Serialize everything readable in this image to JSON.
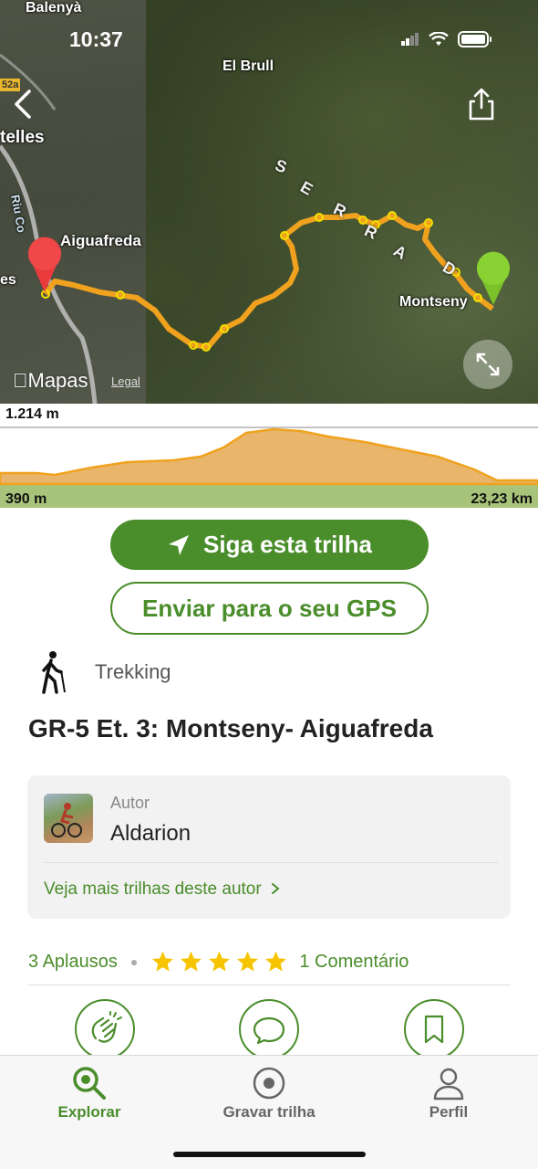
{
  "status_bar": {
    "time": "10:37"
  },
  "map": {
    "labels": {
      "balenya": "Balenyà",
      "el_brull": "El Brull",
      "road_52a": "52a",
      "cardedeu_partial": "telles",
      "rio": "Riu Co",
      "aiguafreda": "Aiguafreda",
      "es_partial": "es",
      "montseny": "Montseny"
    },
    "serra_letters": [
      "S",
      "E",
      "R",
      "R",
      "A",
      "D"
    ],
    "attribution": {
      "logo": "Mapas",
      "legal": "Legal"
    }
  },
  "elevation": {
    "max": "1.214 m",
    "min": "390 m",
    "distance": "23,23 km"
  },
  "actions": {
    "follow_label": "Siga esta trilha",
    "gps_label": "Enviar para o seu GPS"
  },
  "activity": {
    "label": "Trekking",
    "icon": "hiker-icon"
  },
  "trail": {
    "title": "GR-5 Et. 3: Montseny- Aiguafreda"
  },
  "author": {
    "kicker": "Autor",
    "name": "Aldarion",
    "more_link": "Veja mais trilhas deste autor"
  },
  "stats": {
    "applause": "3 Aplausos",
    "rating": 5,
    "rating_max": 5,
    "comments": "1 Comentário"
  },
  "tabbar": {
    "explore": "Explorar",
    "record": "Gravar trilha",
    "profile": "Perfil"
  },
  "colors": {
    "brand_green": "#4a8d2b",
    "route_orange": "#f0a21e",
    "star_yellow": "#f6c400"
  }
}
